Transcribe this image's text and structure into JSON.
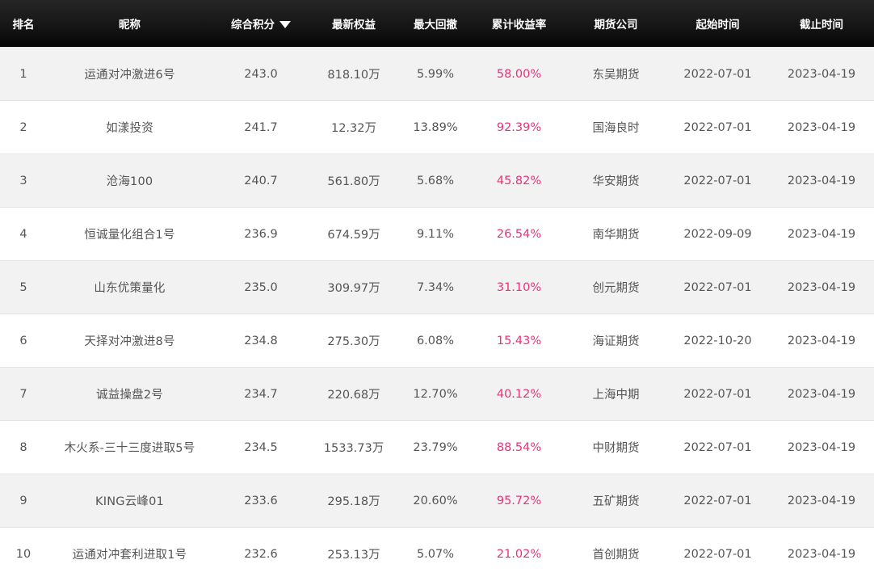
{
  "table": {
    "headers": [
      "排名",
      "昵称",
      "综合积分",
      "最新权益",
      "最大回撤",
      "累计收益率",
      "期货公司",
      "起始时间",
      "截止时间"
    ],
    "sort_indicator_icon": "sort-desc-icon",
    "highlight_color": "#e6337a",
    "rows": [
      {
        "rank": "1",
        "name": "运通对冲激进6号",
        "score": "243.0",
        "equity": "818.10万",
        "drawdown": "5.99%",
        "return": "58.00%",
        "company": "东吴期货",
        "start": "2022-07-01",
        "end": "2023-04-19"
      },
      {
        "rank": "2",
        "name": "如漾投资",
        "score": "241.7",
        "equity": "12.32万",
        "drawdown": "13.89%",
        "return": "92.39%",
        "company": "国海良时",
        "start": "2022-07-01",
        "end": "2023-04-19"
      },
      {
        "rank": "3",
        "name": "沧海100",
        "score": "240.7",
        "equity": "561.80万",
        "drawdown": "5.68%",
        "return": "45.82%",
        "company": "华安期货",
        "start": "2022-07-01",
        "end": "2023-04-19"
      },
      {
        "rank": "4",
        "name": "恒诚量化组合1号",
        "score": "236.9",
        "equity": "674.59万",
        "drawdown": "9.11%",
        "return": "26.54%",
        "company": "南华期货",
        "start": "2022-09-09",
        "end": "2023-04-19"
      },
      {
        "rank": "5",
        "name": "山东优策量化",
        "score": "235.0",
        "equity": "309.97万",
        "drawdown": "7.34%",
        "return": "31.10%",
        "company": "创元期货",
        "start": "2022-07-01",
        "end": "2023-04-19"
      },
      {
        "rank": "6",
        "name": "天择对冲激进8号",
        "score": "234.8",
        "equity": "275.30万",
        "drawdown": "6.08%",
        "return": "15.43%",
        "company": "海证期货",
        "start": "2022-10-20",
        "end": "2023-04-19"
      },
      {
        "rank": "7",
        "name": "诚益操盘2号",
        "score": "234.7",
        "equity": "220.68万",
        "drawdown": "12.70%",
        "return": "40.12%",
        "company": "上海中期",
        "start": "2022-07-01",
        "end": "2023-04-19"
      },
      {
        "rank": "8",
        "name": "木火系-三十三度进取5号",
        "score": "234.5",
        "equity": "1533.73万",
        "drawdown": "23.79%",
        "return": "88.54%",
        "company": "中财期货",
        "start": "2022-07-01",
        "end": "2023-04-19"
      },
      {
        "rank": "9",
        "name": "KING云峰01",
        "score": "233.6",
        "equity": "295.18万",
        "drawdown": "20.60%",
        "return": "95.72%",
        "company": "五矿期货",
        "start": "2022-07-01",
        "end": "2023-04-19"
      },
      {
        "rank": "10",
        "name": "运通对冲套利进取1号",
        "score": "232.6",
        "equity": "253.13万",
        "drawdown": "5.07%",
        "return": "21.02%",
        "company": "首创期货",
        "start": "2022-07-01",
        "end": "2023-04-19"
      }
    ]
  }
}
